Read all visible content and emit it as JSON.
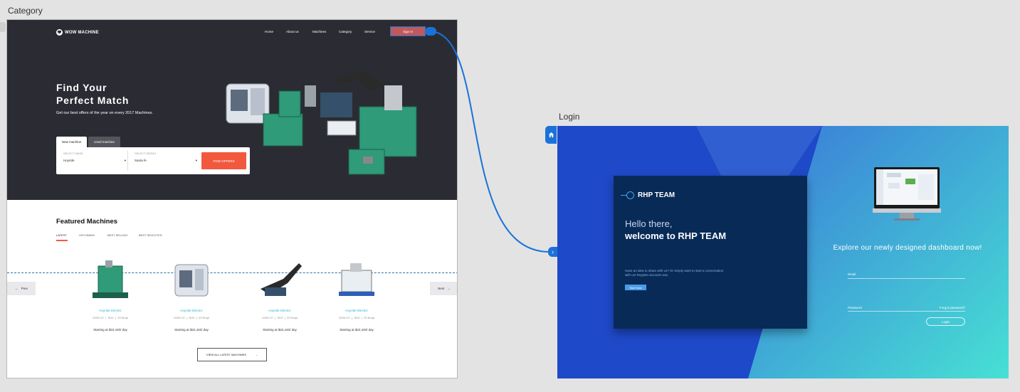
{
  "artboards": {
    "category_label": "Category",
    "login_label": "Login"
  },
  "category": {
    "logo": "WOW MACHINE",
    "nav": [
      "Home",
      "About us",
      "Machines",
      "Category",
      "Service"
    ],
    "signin": "Sign In",
    "hero_title_line1": "Find Your",
    "hero_title_line2": "Perfect Match",
    "hero_subtitle": "Get our best offers of the year on every 2017 Machines.",
    "tabs": [
      "New machine",
      "Used machine"
    ],
    "select_make_caption": "SELECT MAKE",
    "select_make_value": "Hoyride",
    "select_model_caption": "SELECT MODEL",
    "select_model_value": "Santa fe",
    "find_offers": "FIND OFFERS",
    "featured_title": "Featured Machines",
    "featured_tabs": [
      "LATEST",
      "UPCOMING",
      "BEST SELLING",
      "BEST SELECTED"
    ],
    "prev": "Prev",
    "next": "Next",
    "cards": [
      {
        "name": "Hoyride Electric",
        "specs": [
          "2200 CC",
          "SUV",
          "23 Kmpl"
        ],
        "price": "Starting at $22,440/ day"
      },
      {
        "name": "Hoyride Electric",
        "specs": [
          "2200 CC",
          "SUV",
          "23 Kmpl"
        ],
        "price": "Starting at $22,440/ day"
      },
      {
        "name": "Hoyride Electric",
        "specs": [
          "2200 CC",
          "SUV",
          "23 Kmpl"
        ],
        "price": "Starting at $22,440/ day"
      },
      {
        "name": "Hoyride Electric",
        "specs": [
          "2200 CC",
          "SUV",
          "33 Kmpl"
        ],
        "price": "Starting at $22,440/ day"
      }
    ],
    "view_all": "VIEW ALL LATEST MACHINES"
  },
  "login": {
    "brand": "RHP TEAM",
    "greeting": "Hello there,",
    "welcome": "welcome to RHP TEAM",
    "idea_text": "Have an idea to share with us? Or simply want to start a conversation with us! Register account now.",
    "start_now": "Start Now",
    "explore": "Explore our newly designed dashboard now!",
    "email_label": "Email",
    "password_label": "Password",
    "forgot": "Forgot password?",
    "login_button": "Login"
  },
  "colors": {
    "hero_bg": "#2b2c33",
    "accent_orange": "#f2583e",
    "link_blue": "#1a72d9",
    "login_navy": "#082a57"
  }
}
